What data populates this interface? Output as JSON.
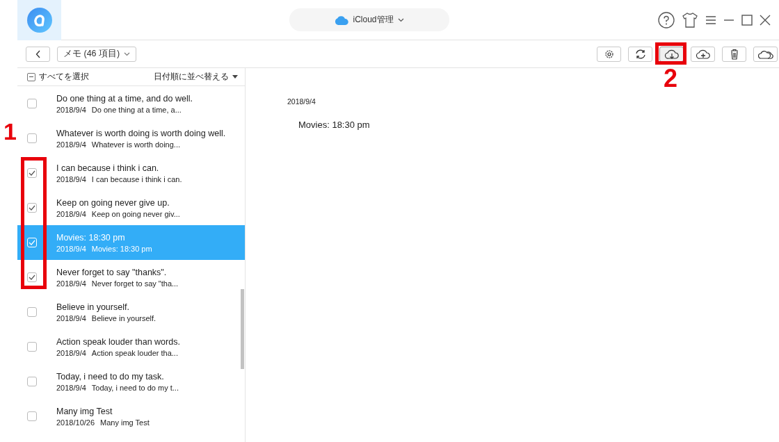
{
  "header": {
    "service": "iCloud管理"
  },
  "toolbar": {
    "category": "メモ (46 項目)",
    "buttons": [
      {
        "kind": "settings",
        "selected": false
      },
      {
        "kind": "refresh",
        "selected": false
      },
      {
        "kind": "download",
        "selected": true
      },
      {
        "kind": "upload",
        "selected": false
      },
      {
        "kind": "delete",
        "selected": false
      },
      {
        "kind": "cloud",
        "selected": false
      }
    ]
  },
  "list": {
    "select_all": "すべてを選択",
    "select_all_partial": true,
    "sort": "日付順に並べ替える",
    "items": [
      {
        "title": "Do one thing at a time, and do well.",
        "date": "2018/9/4",
        "preview": "Do one thing at a time, a...",
        "checked": false,
        "selected": false
      },
      {
        "title": "Whatever is worth doing is worth doing well.",
        "date": "2018/9/4",
        "preview": "Whatever is worth doing...",
        "checked": false,
        "selected": false
      },
      {
        "title": "I can because i think i can.",
        "date": "2018/9/4",
        "preview": "I can because i think i can.",
        "checked": true,
        "selected": false
      },
      {
        "title": "Keep on going never give up.",
        "date": "2018/9/4",
        "preview": "Keep on going never giv...",
        "checked": true,
        "selected": false
      },
      {
        "title": "Movies: 18:30 pm",
        "date": "2018/9/4",
        "preview": "Movies: 18:30 pm",
        "checked": true,
        "selected": true
      },
      {
        "title": "Never forget to say \"thanks\".",
        "date": "2018/9/4",
        "preview": "Never forget to say \"tha...",
        "checked": true,
        "selected": false
      },
      {
        "title": "Believe in yourself.",
        "date": "2018/9/4",
        "preview": "Believe in yourself.",
        "checked": false,
        "selected": false
      },
      {
        "title": "Action speak louder than words.",
        "date": "2018/9/4",
        "preview": "Action speak louder tha...",
        "checked": false,
        "selected": false
      },
      {
        "title": "Today, i need to do my task.",
        "date": "2018/9/4",
        "preview": "Today, i need to do my t...",
        "checked": false,
        "selected": false
      },
      {
        "title": "Many img Test",
        "date": "2018/10/26",
        "preview": "Many img Test",
        "checked": false,
        "selected": false
      }
    ]
  },
  "detail": {
    "date": "2018/9/4",
    "body": "Movies: 18:30 pm"
  },
  "annotations": [
    {
      "label": "1"
    },
    {
      "label": "2"
    }
  ]
}
